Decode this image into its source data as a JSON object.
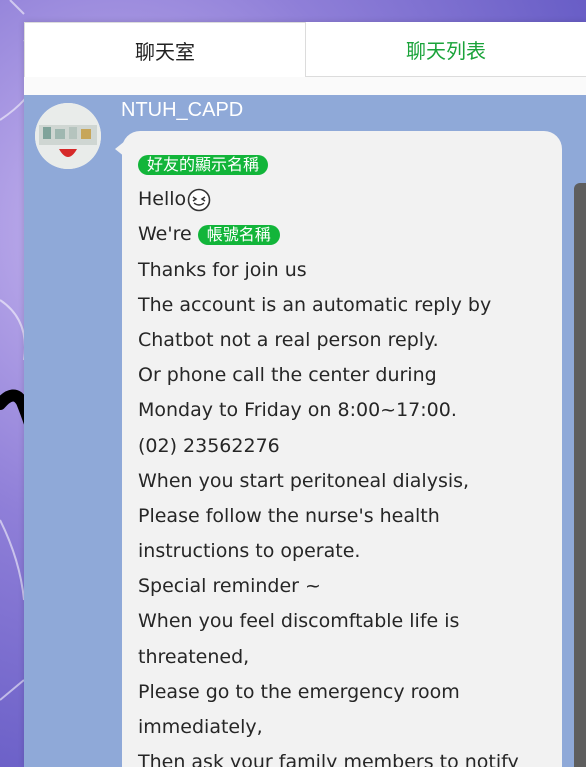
{
  "tabs": {
    "chat_room": "聊天室",
    "chat_list": "聊天列表"
  },
  "message": {
    "sender": "NTUH_CAPD",
    "friend_name_tag": "好友的顯示名稱",
    "hello": "Hello",
    "emoji": "laughing-squint-emoji",
    "were": "We're",
    "account_name_tag": "帳號名稱",
    "lines": [
      "Thanks for join us",
      "The account is an automatic reply by",
      "Chatbot not a real person reply.",
      "Or  phone call the  center during",
      "Monday to Friday on 8:00~17:00.",
      "(02) 23562276",
      "When you start peritoneal dialysis,",
      "Please follow the nurse's health",
      "instructions to operate.",
      "Special reminder ~",
      "When you feel discomftable life is",
      "threatened,",
      "Please go to the emergency room",
      "immediately,",
      "Then ask  your family members to notify"
    ]
  },
  "colors": {
    "chat_background": "#8fa9d8",
    "tag_green": "#12b53a",
    "tab_active_text": "#222222",
    "tab_inactive_text": "#1aa33a"
  }
}
